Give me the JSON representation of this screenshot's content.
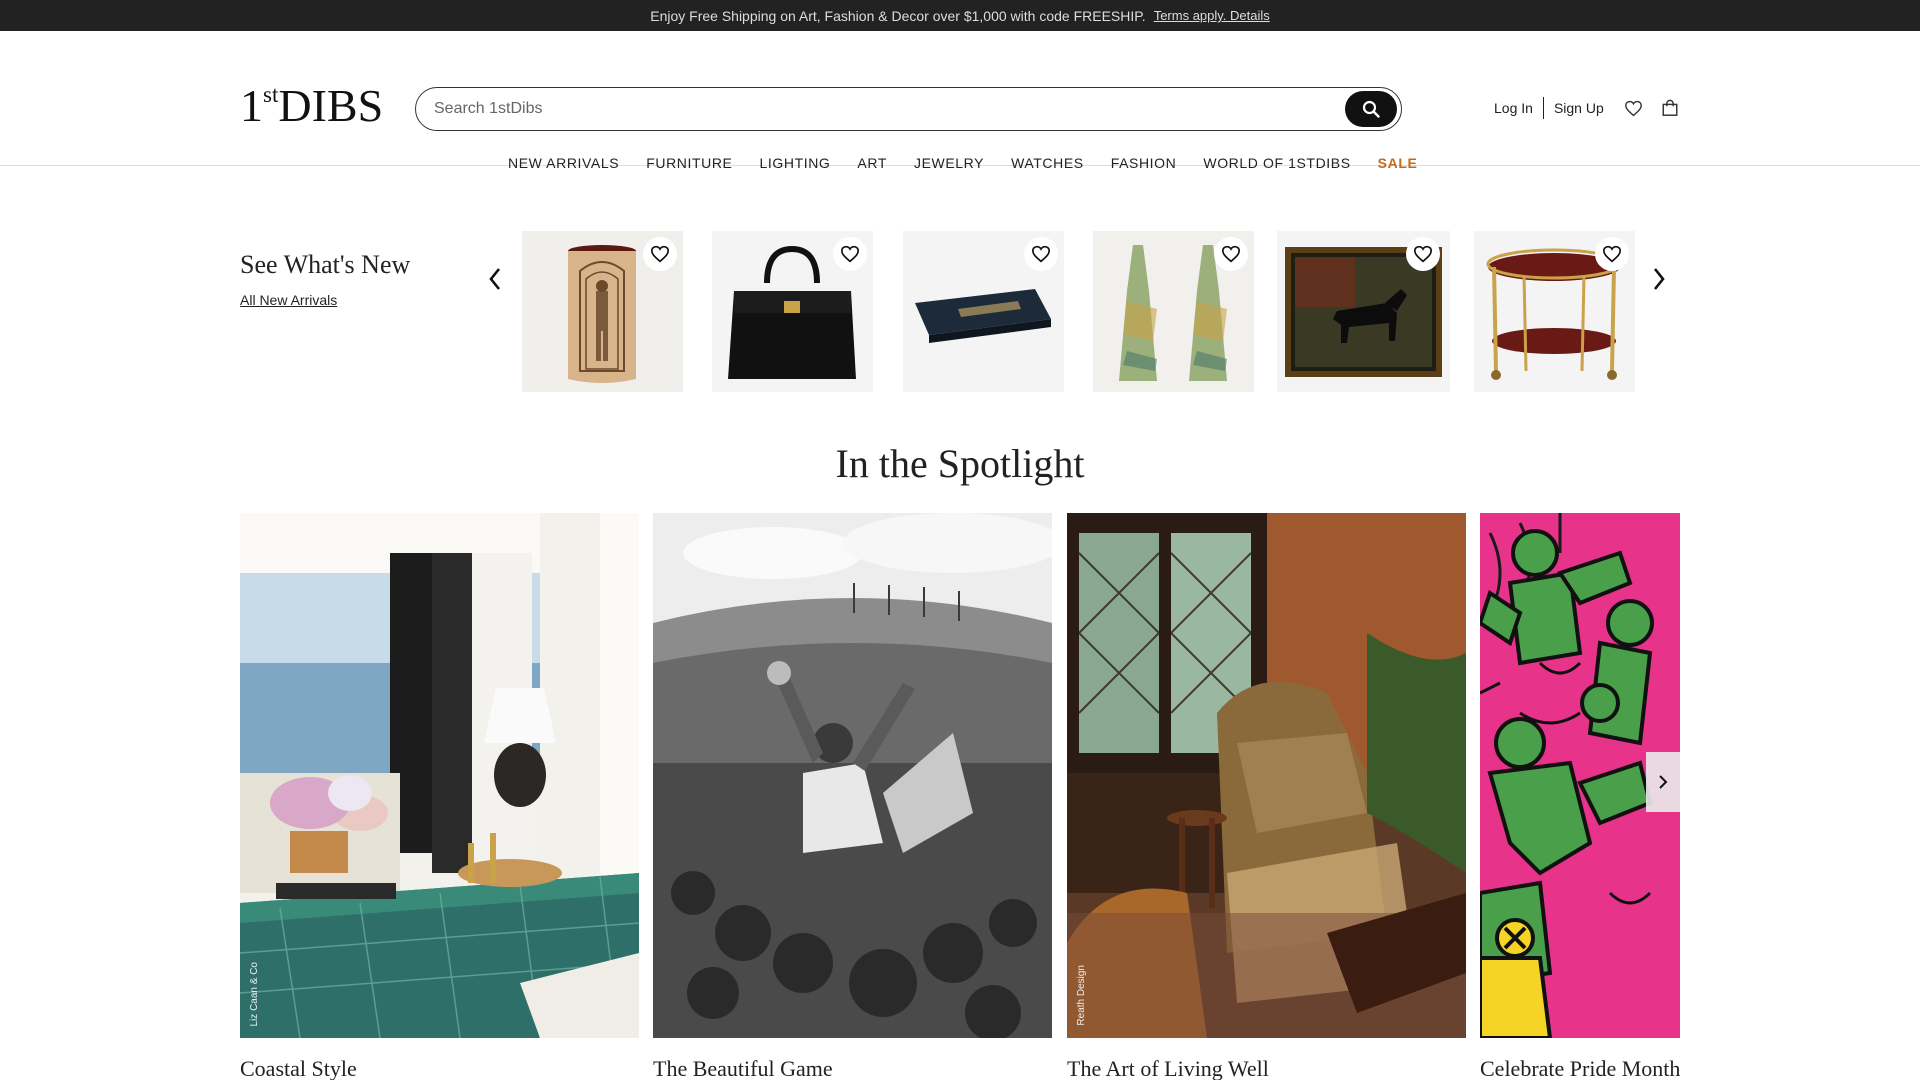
{
  "promo": {
    "text": "Enjoy Free Shipping on Art, Fashion & Decor over $1,000 with code FREESHIP.",
    "link": "Terms apply. Details"
  },
  "header": {
    "logo_main": "1",
    "logo_sup_top": "st",
    "logo_tail": "DIBS",
    "search_placeholder": "Search 1stDibs",
    "login": "Log In",
    "signup": "Sign Up"
  },
  "nav": [
    "NEW ARRIVALS",
    "FURNITURE",
    "LIGHTING",
    "ART",
    "JEWELRY",
    "WATCHES",
    "FASHION",
    "WORLD OF 1STDIBS",
    "SALE"
  ],
  "whats_new": {
    "title": "See What's New",
    "link": "All New Arrivals",
    "items": [
      "vase",
      "handbag",
      "tray",
      "dress",
      "painting",
      "bar-cart"
    ]
  },
  "spotlight": {
    "title": "In the Spotlight",
    "cards": [
      {
        "caption": "Coastal Style",
        "credit": "Liz Caan & Co"
      },
      {
        "caption": "The Beautiful Game",
        "credit": ""
      },
      {
        "caption": "The Art of Living Well",
        "credit": "Reath Design"
      },
      {
        "caption": "Celebrate Pride Month",
        "credit": ""
      }
    ]
  },
  "colors": {
    "promo_bg": "#222222",
    "sale": "#c56a1d"
  }
}
